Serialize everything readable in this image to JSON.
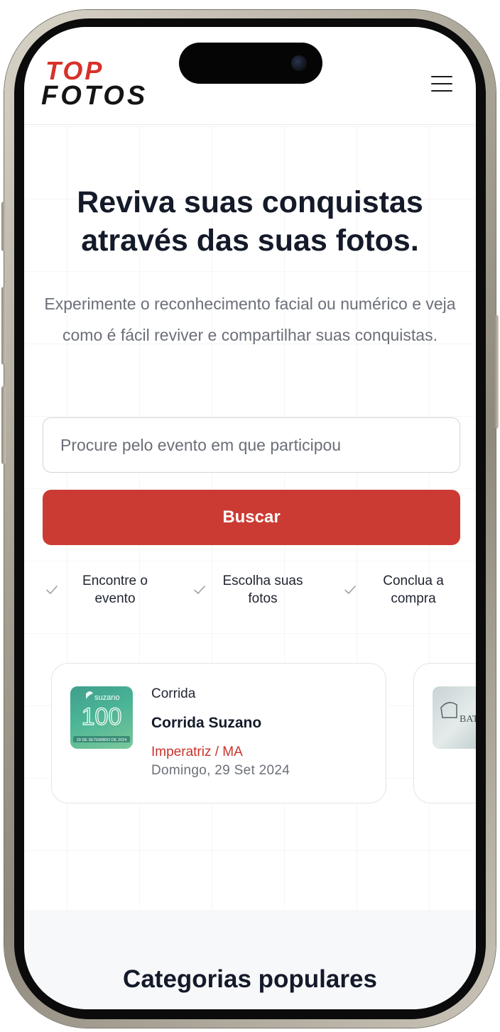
{
  "header": {
    "logo_top": "TOP",
    "logo_bottom": "FOTOS",
    "menu_icon": "hamburger-icon"
  },
  "hero": {
    "title": "Reviva suas conquistas através das suas fotos.",
    "subtitle": "Experimente o reconhecimento facial ou numérico e veja como é fácil reviver e compartilhar suas conquistas."
  },
  "search": {
    "placeholder": "Procure pelo evento em que participou",
    "button_label": "Buscar"
  },
  "steps": [
    {
      "label": "Encontre o evento",
      "icon": "check-icon"
    },
    {
      "label": "Escolha suas fotos",
      "icon": "check-icon"
    },
    {
      "label": "Conclua a compra",
      "icon": "check-icon"
    }
  ],
  "events": [
    {
      "category": "Corrida",
      "title": "Corrida Suzano",
      "location": "Imperatriz / MA",
      "date": "Domingo, 29 Set 2024",
      "thumb_brand": "suzano",
      "thumb_number": "100",
      "thumb_date": "29 DE SETEMBRO DE 2024"
    },
    {
      "thumb_text": "BATIS"
    }
  ],
  "popular": {
    "title": "Categorias populares"
  },
  "colors": {
    "brand_red": "#cc3b33",
    "location_red": "#c8332a",
    "heading": "#141a29",
    "muted": "#6b6f78"
  }
}
